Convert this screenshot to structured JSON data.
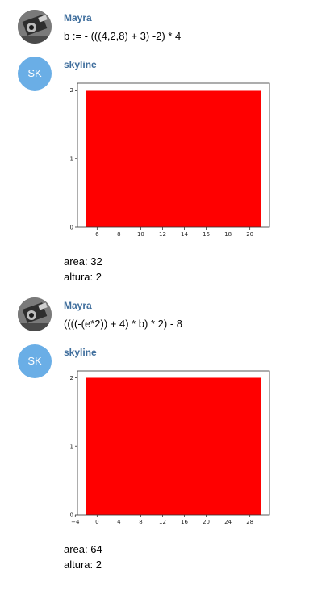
{
  "messages": [
    {
      "sender": "Mayra",
      "avatar": "photo",
      "text": "b := - (((4,2,8) + 3) -2) * 4"
    },
    {
      "sender": "skyline",
      "avatar_initials": "SK",
      "chart_data": {
        "type": "bar",
        "series": [
          {
            "x_start": 5,
            "x_end": 21,
            "value": 2
          }
        ],
        "xlim": [
          4.2,
          21.8
        ],
        "ylim": [
          0,
          2.1
        ],
        "xticks": [
          6,
          8,
          10,
          12,
          14,
          16,
          18,
          20
        ],
        "yticks": [
          0,
          1,
          2
        ],
        "color": "#ff0000",
        "title": "",
        "xlabel": "",
        "ylabel": ""
      },
      "lines": [
        "area: 32",
        "altura: 2"
      ]
    },
    {
      "sender": "Mayra",
      "avatar": "photo",
      "text": "((((-(e*2)) + 4) * b) * 2) - 8"
    },
    {
      "sender": "skyline",
      "avatar_initials": "SK",
      "chart_data": {
        "type": "bar",
        "series": [
          {
            "x_start": -2,
            "x_end": 30,
            "value": 2
          }
        ],
        "xlim": [
          -3.6,
          31.6
        ],
        "ylim": [
          0,
          2.1
        ],
        "xticks": [
          -4,
          0,
          4,
          8,
          12,
          16,
          20,
          24,
          28
        ],
        "yticks": [
          0,
          1,
          2
        ],
        "color": "#ff0000",
        "title": "",
        "xlabel": "",
        "ylabel": ""
      },
      "lines": [
        "area: 64",
        "altura: 2"
      ]
    }
  ]
}
